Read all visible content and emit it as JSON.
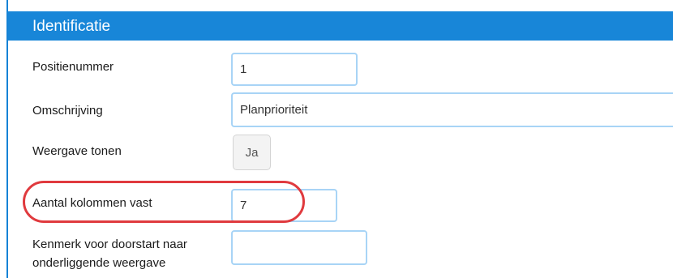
{
  "section": {
    "title": "Identificatie"
  },
  "fields": {
    "positienummer": {
      "label": "Positienummer",
      "value": "1"
    },
    "omschrijving": {
      "label": "Omschrijving",
      "value": "Planprioriteit"
    },
    "weergave_tonen": {
      "label": "Weergave tonen",
      "value": "Ja"
    },
    "aantal_kolommen_vast": {
      "label": "Aantal kolommen vast",
      "value": "7"
    },
    "kenmerk_doorstart": {
      "label_line1": "Kenmerk voor doorstart naar",
      "label_line2": "onderliggende weergave",
      "value": ""
    }
  },
  "colors": {
    "header": "#1886d8",
    "field_border": "#a8d4f6",
    "highlight": "#e03a3e"
  }
}
